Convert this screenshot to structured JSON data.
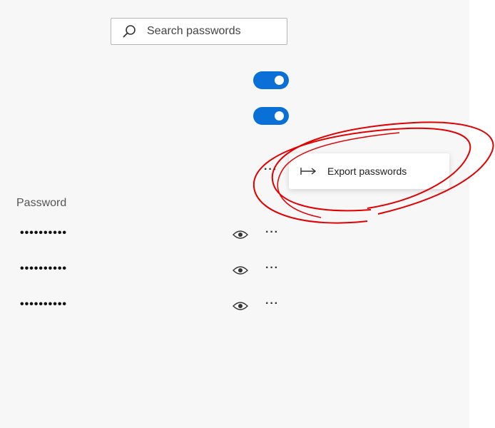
{
  "search": {
    "placeholder": "Search passwords",
    "icon": "search-icon"
  },
  "toggles": [
    {
      "state": "on"
    },
    {
      "state": "on"
    }
  ],
  "settings_menu": {
    "trigger": "···",
    "items": [
      {
        "label": "Export passwords",
        "icon": "export-icon"
      }
    ]
  },
  "list": {
    "column_header": "Password",
    "rows": [
      {
        "password": "••••••••••",
        "more": "···"
      },
      {
        "password": "••••••••••",
        "more": "···"
      },
      {
        "password": "••••••••••",
        "more": "···"
      }
    ]
  },
  "colors": {
    "accent": "#0a6fd6",
    "annotation": "#e00000",
    "panel_bg": "#f7f7f7"
  }
}
